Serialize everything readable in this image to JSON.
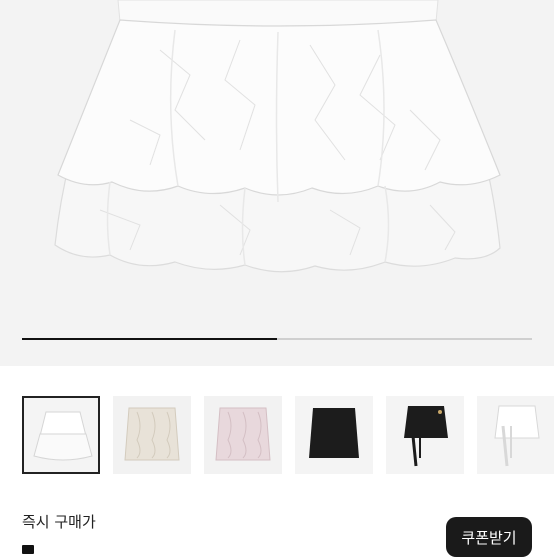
{
  "product": {
    "main_image_icon": "white-tiered-ruffle-skirt-photo",
    "gallery_progress": 0.5
  },
  "thumbnails": [
    {
      "icon": "white-ruffle-skirt-icon",
      "selected": true
    },
    {
      "icon": "ivory-cable-knit-skirt-icon",
      "selected": false
    },
    {
      "icon": "pink-cable-knit-skirt-icon",
      "selected": false
    },
    {
      "icon": "black-mini-skirt-icon",
      "selected": false
    },
    {
      "icon": "black-wrap-skirt-icon",
      "selected": false
    },
    {
      "icon": "white-wrap-skirt-icon",
      "selected": false
    }
  ],
  "purchase": {
    "instant_price_label": "즉시 구매가",
    "coupon_button_label": "쿠폰받기"
  },
  "colors": {
    "accent": "#1a1a1a",
    "image_bg": "#f3f3f3"
  }
}
